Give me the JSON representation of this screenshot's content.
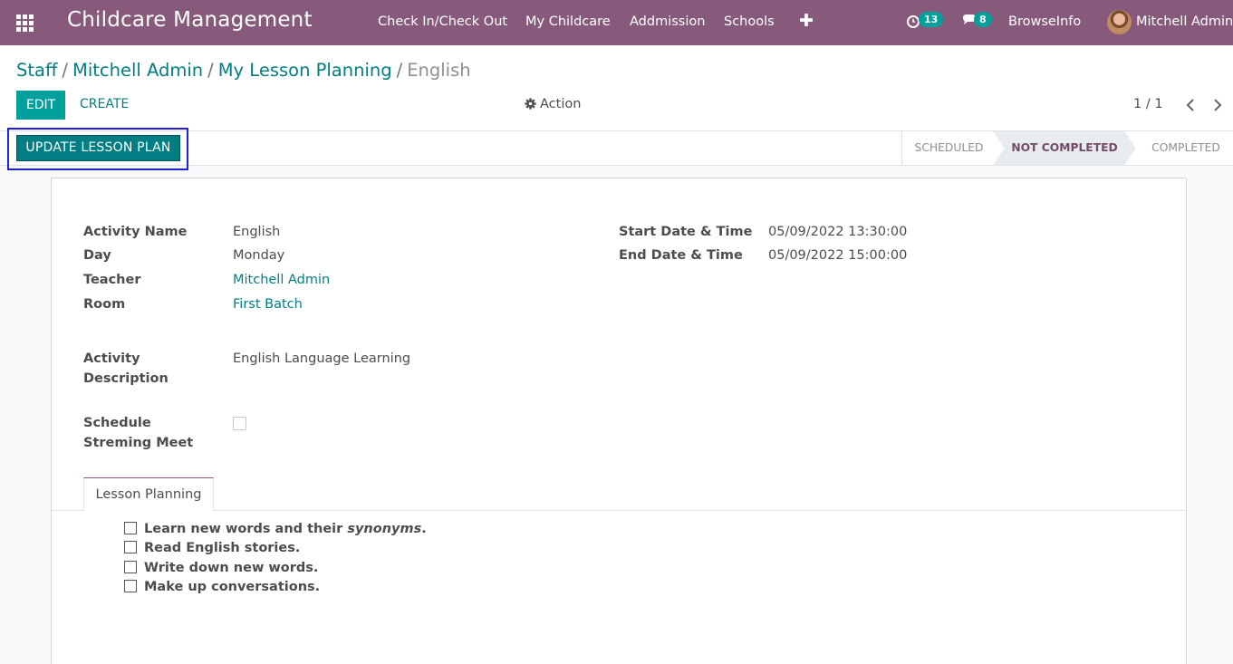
{
  "navbar": {
    "brand": "Childcare Management",
    "menu": [
      "Check In/Check Out",
      "My Childcare",
      "Addmission",
      "Schools"
    ],
    "activities_count": "13",
    "messages_count": "8",
    "company": "BrowseInfo",
    "user": "Mitchell Admin"
  },
  "breadcrumb": {
    "items": [
      "Staff",
      "Mitchell Admin",
      "My Lesson Planning"
    ],
    "current": "English"
  },
  "controls": {
    "edit_label": "EDIT",
    "create_label": "CREATE",
    "action_label": "Action",
    "pager": "1 / 1"
  },
  "statusbar": {
    "update_button": "UPDATE LESSON PLAN",
    "stages": [
      "SCHEDULED",
      "NOT COMPLETED",
      "COMPLETED"
    ],
    "active_stage": "NOT COMPLETED"
  },
  "form": {
    "activity_name_label": "Activity Name",
    "activity_name": "English",
    "day_label": "Day",
    "day": "Monday",
    "teacher_label": "Teacher",
    "teacher": "Mitchell Admin",
    "room_label": "Room",
    "room": "First Batch",
    "start_label": "Start Date & Time",
    "start": "05/09/2022 13:30:00",
    "end_label": "End Date & Time",
    "end": "05/09/2022 15:00:00",
    "description_label_1": "Activity",
    "description_label_2": "Description",
    "description": "English Language Learning",
    "meet_label_1": "Schedule",
    "meet_label_2": "Streming Meet",
    "meet_checked": false
  },
  "tabs": {
    "lesson_planning": "Lesson Planning"
  },
  "lesson_items": {
    "item1_prefix": "Learn new words and their ",
    "item1_emph": "synonyms",
    "item1_suffix": ".",
    "item2": "Read English stories.",
    "item3": "Write down new words.",
    "item4": "Make up conversations."
  },
  "colors": {
    "navbar": "#875a7b",
    "accent": "#00a09d",
    "link": "#017e84",
    "highlight": "#1f1fd8"
  }
}
